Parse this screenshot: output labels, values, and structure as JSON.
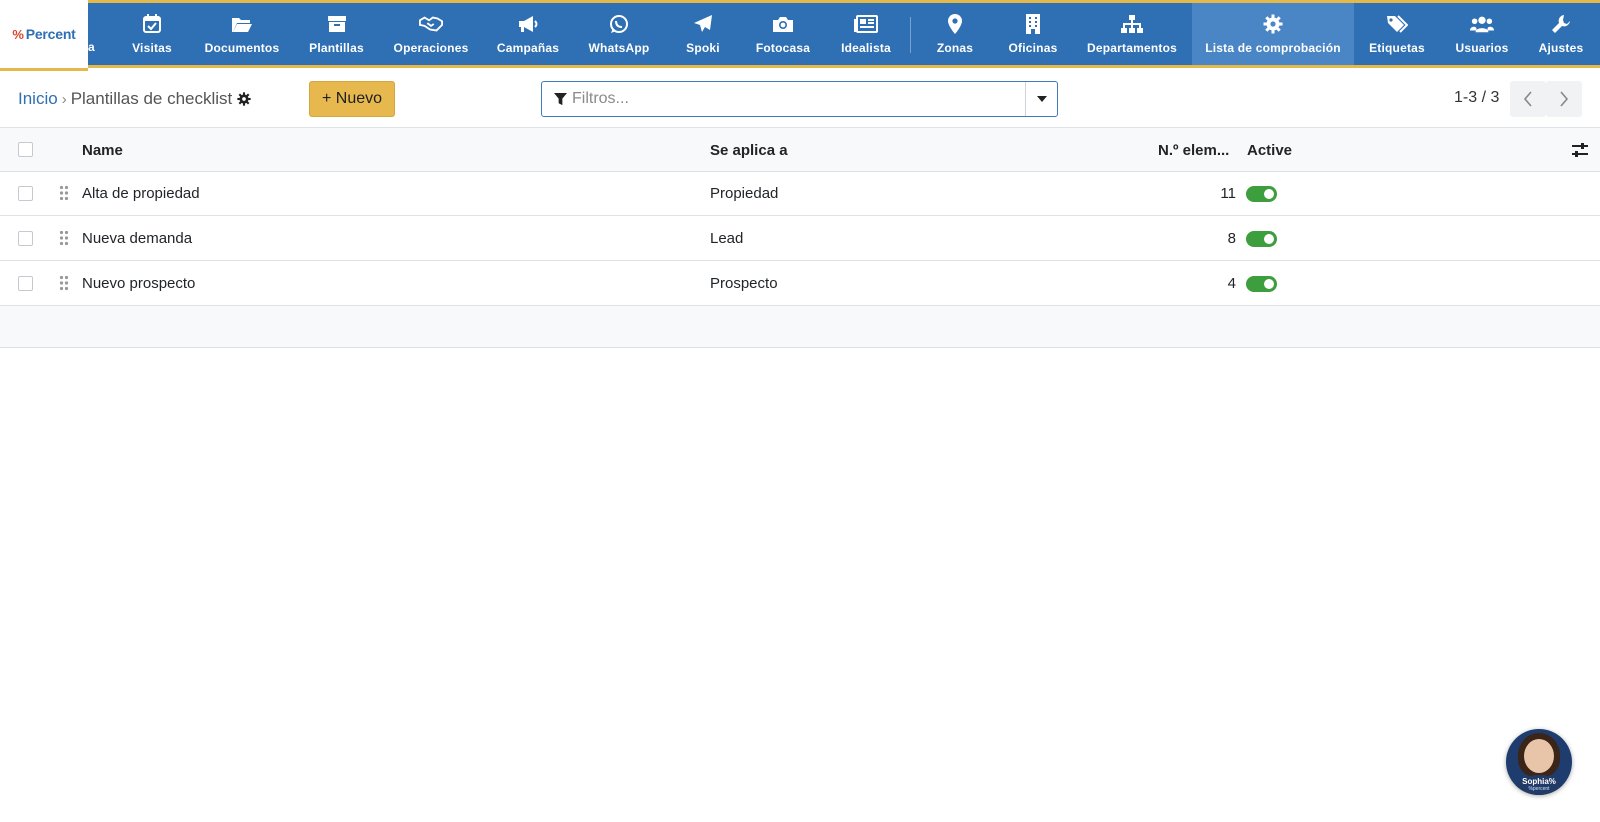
{
  "brand": {
    "logo_text": "Percent",
    "logo_mark": "%"
  },
  "nav": {
    "partial_label": "a",
    "items": [
      {
        "label": "Visitas",
        "icon": "calendar-check-icon"
      },
      {
        "label": "Documentos",
        "icon": "folder-open-icon"
      },
      {
        "label": "Plantillas",
        "icon": "archive-icon"
      },
      {
        "label": "Operaciones",
        "icon": "handshake-icon"
      },
      {
        "label": "Campañas",
        "icon": "megaphone-icon"
      },
      {
        "label": "WhatsApp",
        "icon": "whatsapp-icon"
      },
      {
        "label": "Spoki",
        "icon": "paper-plane-icon"
      },
      {
        "label": "Fotocasa",
        "icon": "camera-icon"
      },
      {
        "label": "Idealista",
        "icon": "newspaper-icon"
      },
      {
        "label": "Zonas",
        "icon": "map-marker-icon"
      },
      {
        "label": "Oficinas",
        "icon": "building-icon"
      },
      {
        "label": "Departamentos",
        "icon": "sitemap-icon"
      },
      {
        "label": "Lista de comprobación",
        "icon": "gear-icon",
        "active": true
      },
      {
        "label": "Etiquetas",
        "icon": "tags-icon"
      },
      {
        "label": "Usuarios",
        "icon": "users-icon"
      },
      {
        "label": "Ajustes",
        "icon": "wrench-icon"
      }
    ]
  },
  "breadcrumb": {
    "home": "Inicio",
    "separator": "›",
    "current": "Plantillas de checklist"
  },
  "toolbar": {
    "new_label": "+ Nuevo",
    "filter_placeholder": "Filtros..."
  },
  "pager": {
    "text": "1-3 / 3"
  },
  "table": {
    "columns": {
      "name": "Name",
      "applies_to": "Se aplica a",
      "count": "N.º elem...",
      "active": "Active"
    },
    "rows": [
      {
        "name": "Alta de propiedad",
        "applies_to": "Propiedad",
        "count": "11",
        "active": true
      },
      {
        "name": "Nueva demanda",
        "applies_to": "Lead",
        "count": "8",
        "active": true
      },
      {
        "name": "Nuevo prospecto",
        "applies_to": "Prospecto",
        "count": "4",
        "active": true
      }
    ]
  },
  "assistant": {
    "name": "Sophia%",
    "sub": "%percent"
  },
  "colors": {
    "navbar": "#2f6fb4",
    "accent": "#e6b84e",
    "toggle_on": "#3c9e3c"
  }
}
